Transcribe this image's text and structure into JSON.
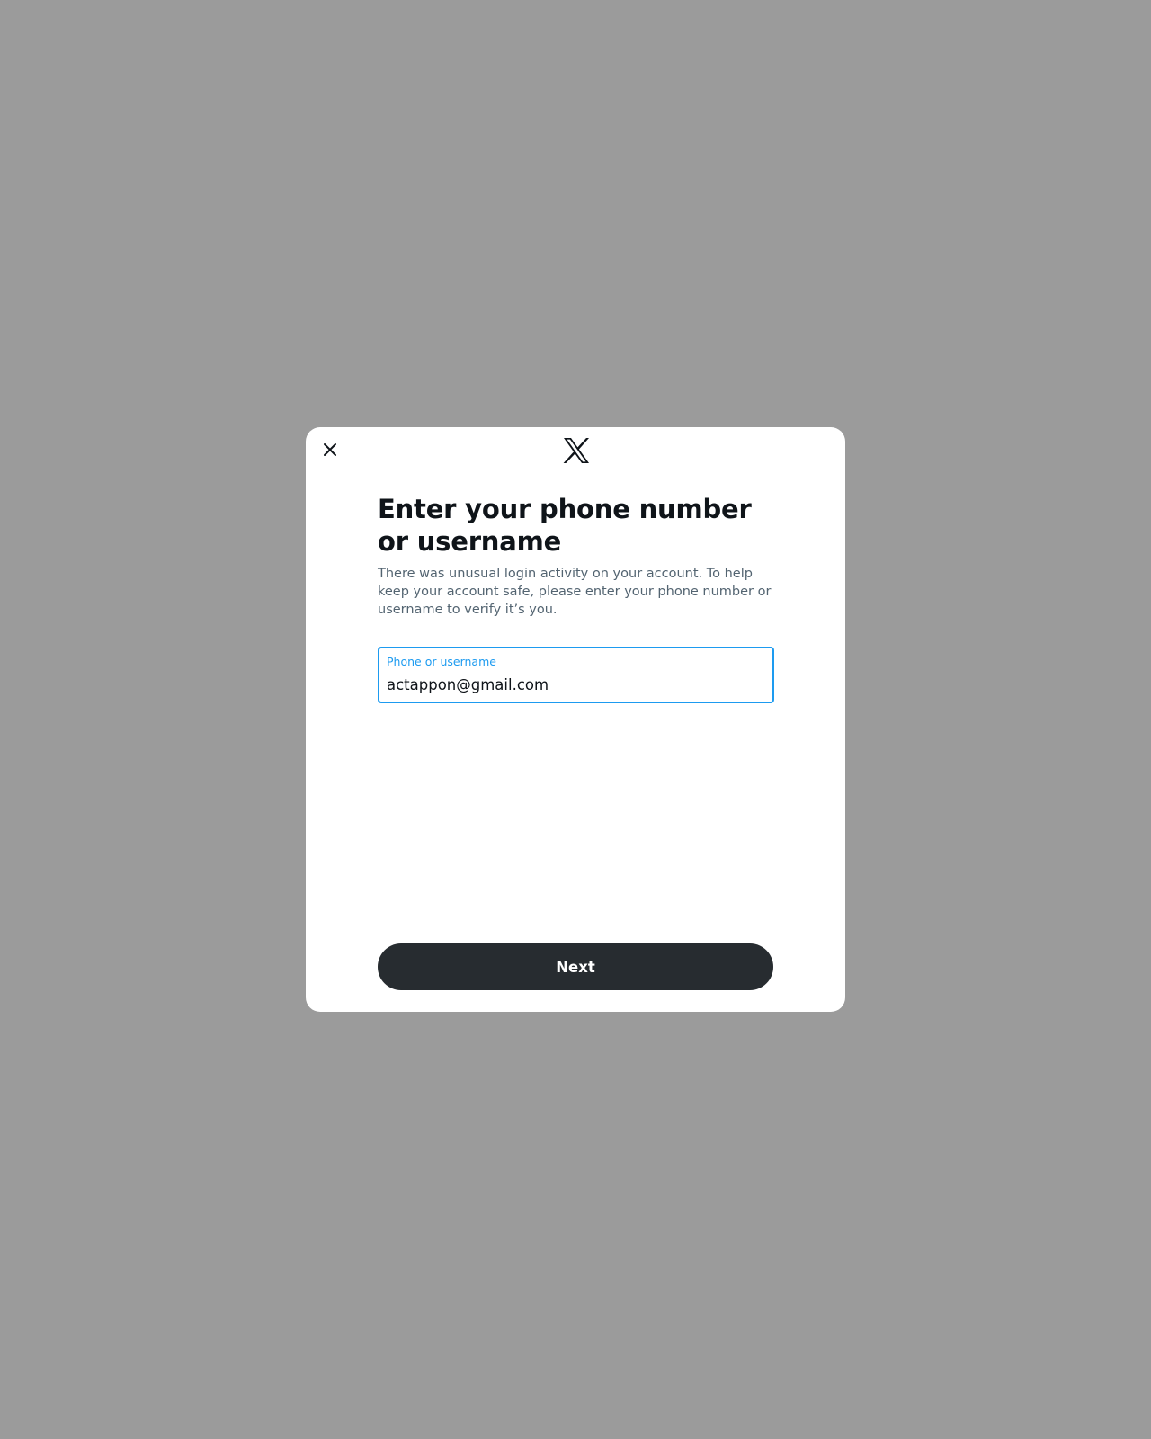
{
  "modal": {
    "close_icon": "close-icon",
    "logo_icon": "x-logo-icon",
    "title": "Enter your phone number or username",
    "description": "There was unusual login activity on your account. To help keep your account safe, please enter your phone number or username to verify it’s you.",
    "field": {
      "label": "Phone or username",
      "value": "actappon@gmail.com"
    },
    "next_label": "Next"
  },
  "colors": {
    "accent": "#1d9bf0",
    "button": "#272c30",
    "backdrop": "#9b9b9b"
  }
}
